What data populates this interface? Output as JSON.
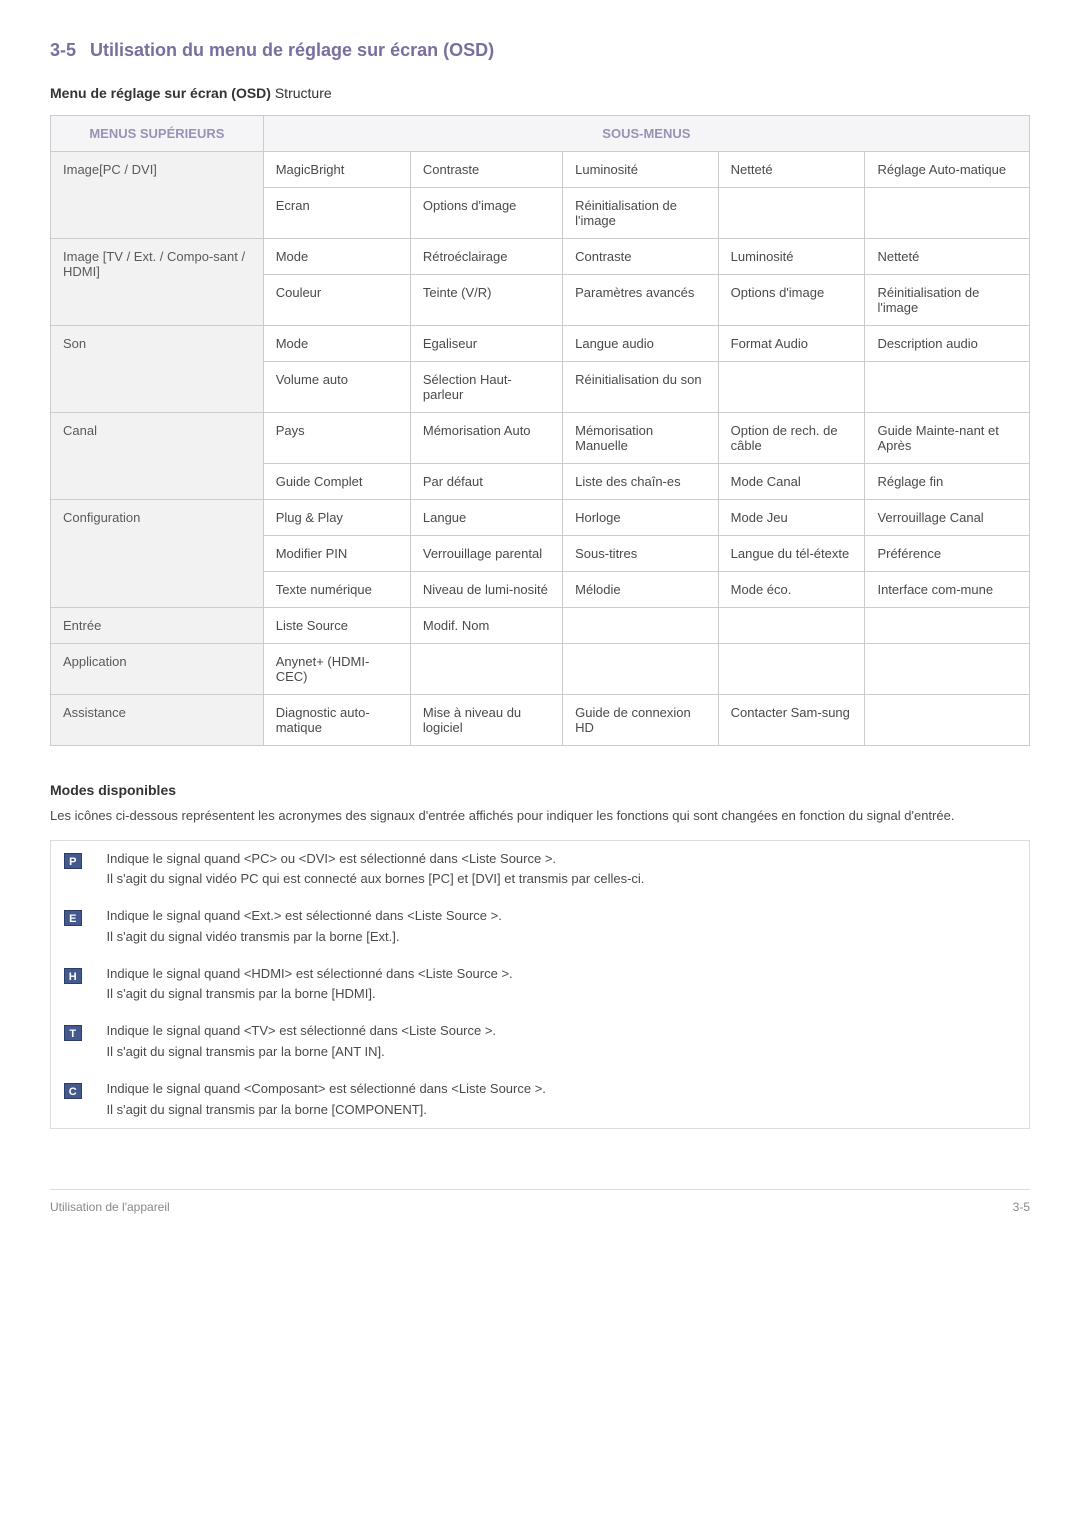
{
  "section": {
    "num": "3-5",
    "title": "Utilisation du menu de réglage sur écran (OSD)"
  },
  "subtitle": {
    "bold": "Menu de réglage sur écran (OSD)",
    "rest": " Structure"
  },
  "table_header": {
    "menus": "MENUS SUPÉRIEURS",
    "sousmenus": "SOUS-MENUS"
  },
  "rows": [
    {
      "menu": "Image[PC / DVI]",
      "cells": [
        "MagicBright",
        "Contraste",
        "Luminosité",
        "Netteté",
        "Réglage Auto-matique"
      ],
      "rowspan": 2
    },
    {
      "menu": "",
      "cells": [
        "Ecran",
        "Options d'image",
        "Réinitialisation de l'image",
        "",
        ""
      ]
    },
    {
      "menu": "Image [TV / Ext. / Compo-sant / HDMI]",
      "cells": [
        "Mode",
        "Rétroéclairage",
        "Contraste",
        "Luminosité",
        "Netteté"
      ],
      "rowspan": 2
    },
    {
      "menu": "",
      "cells": [
        "Couleur",
        "Teinte (V/R)",
        "Paramètres avancés",
        "Options d'image",
        "Réinitialisation de l'image"
      ]
    },
    {
      "menu": "Son",
      "cells": [
        "Mode",
        "Egaliseur",
        "Langue audio",
        "Format Audio",
        "Description audio"
      ],
      "rowspan": 2
    },
    {
      "menu": "",
      "cells": [
        "Volume auto",
        "Sélection Haut-parleur",
        "Réinitialisation du son",
        "",
        ""
      ]
    },
    {
      "menu": "Canal",
      "cells": [
        "Pays",
        "Mémorisation Auto",
        "Mémorisation Manuelle",
        "Option de rech. de câble",
        "Guide Mainte-nant et Après"
      ],
      "rowspan": 2
    },
    {
      "menu": "",
      "cells": [
        "Guide Complet",
        "Par défaut",
        "Liste des chaîn-es",
        "Mode Canal",
        "Réglage fin"
      ]
    },
    {
      "menu": "Configuration",
      "cells": [
        "Plug & Play",
        "Langue",
        "Horloge",
        "Mode Jeu",
        "Verrouillage Canal"
      ],
      "rowspan": 3
    },
    {
      "menu": "",
      "cells": [
        "Modifier PIN",
        "Verrouillage parental",
        "Sous-titres",
        "Langue du tél-étexte",
        "Préférence"
      ]
    },
    {
      "menu": "",
      "cells": [
        "Texte numérique",
        "Niveau de lumi-nosité",
        "Mélodie",
        "Mode éco.",
        "Interface com-mune"
      ]
    },
    {
      "menu": "Entrée",
      "cells": [
        "Liste Source",
        "Modif. Nom",
        "",
        "",
        ""
      ]
    },
    {
      "menu": "Application",
      "cells": [
        "Anynet+ (HDMI-CEC)",
        "",
        "",
        "",
        ""
      ]
    },
    {
      "menu": "Assistance",
      "cells": [
        "Diagnostic auto-matique",
        "Mise à niveau du logiciel",
        "Guide de connexion HD",
        "Contacter Sam-sung",
        ""
      ]
    }
  ],
  "modes": {
    "heading": "Modes disponibles",
    "intro": "Les icônes ci-dessous représentent les acronymes des signaux d'entrée affichés pour indiquer les fonctions qui sont changées en fonction du signal d'entrée.",
    "items": [
      {
        "icon": "P",
        "line1": "Indique le signal quand <PC> ou <DVI> est sélectionné dans <Liste Source >.",
        "line2": "Il s'agit du signal vidéo PC qui est connecté aux bornes [PC] et [DVI] et transmis par celles-ci."
      },
      {
        "icon": "E",
        "line1": "Indique le signal quand <Ext.> est sélectionné dans <Liste Source >.",
        "line2": "Il s'agit du signal vidéo transmis par la borne [Ext.]."
      },
      {
        "icon": "H",
        "line1": "Indique le signal quand <HDMI> est sélectionné dans <Liste Source >.",
        "line2": "Il s'agit du signal transmis par la borne [HDMI]."
      },
      {
        "icon": "T",
        "line1": "Indique le signal quand <TV> est sélectionné dans <Liste Source >.",
        "line2": "Il s'agit du signal transmis par la borne [ANT IN]."
      },
      {
        "icon": "C",
        "line1": "Indique le signal quand <Composant> est sélectionné dans <Liste Source >.",
        "line2": "Il s'agit du signal transmis par la borne [COMPONENT]."
      }
    ]
  },
  "footer": {
    "left": "Utilisation de l'appareil",
    "right": "3-5"
  }
}
